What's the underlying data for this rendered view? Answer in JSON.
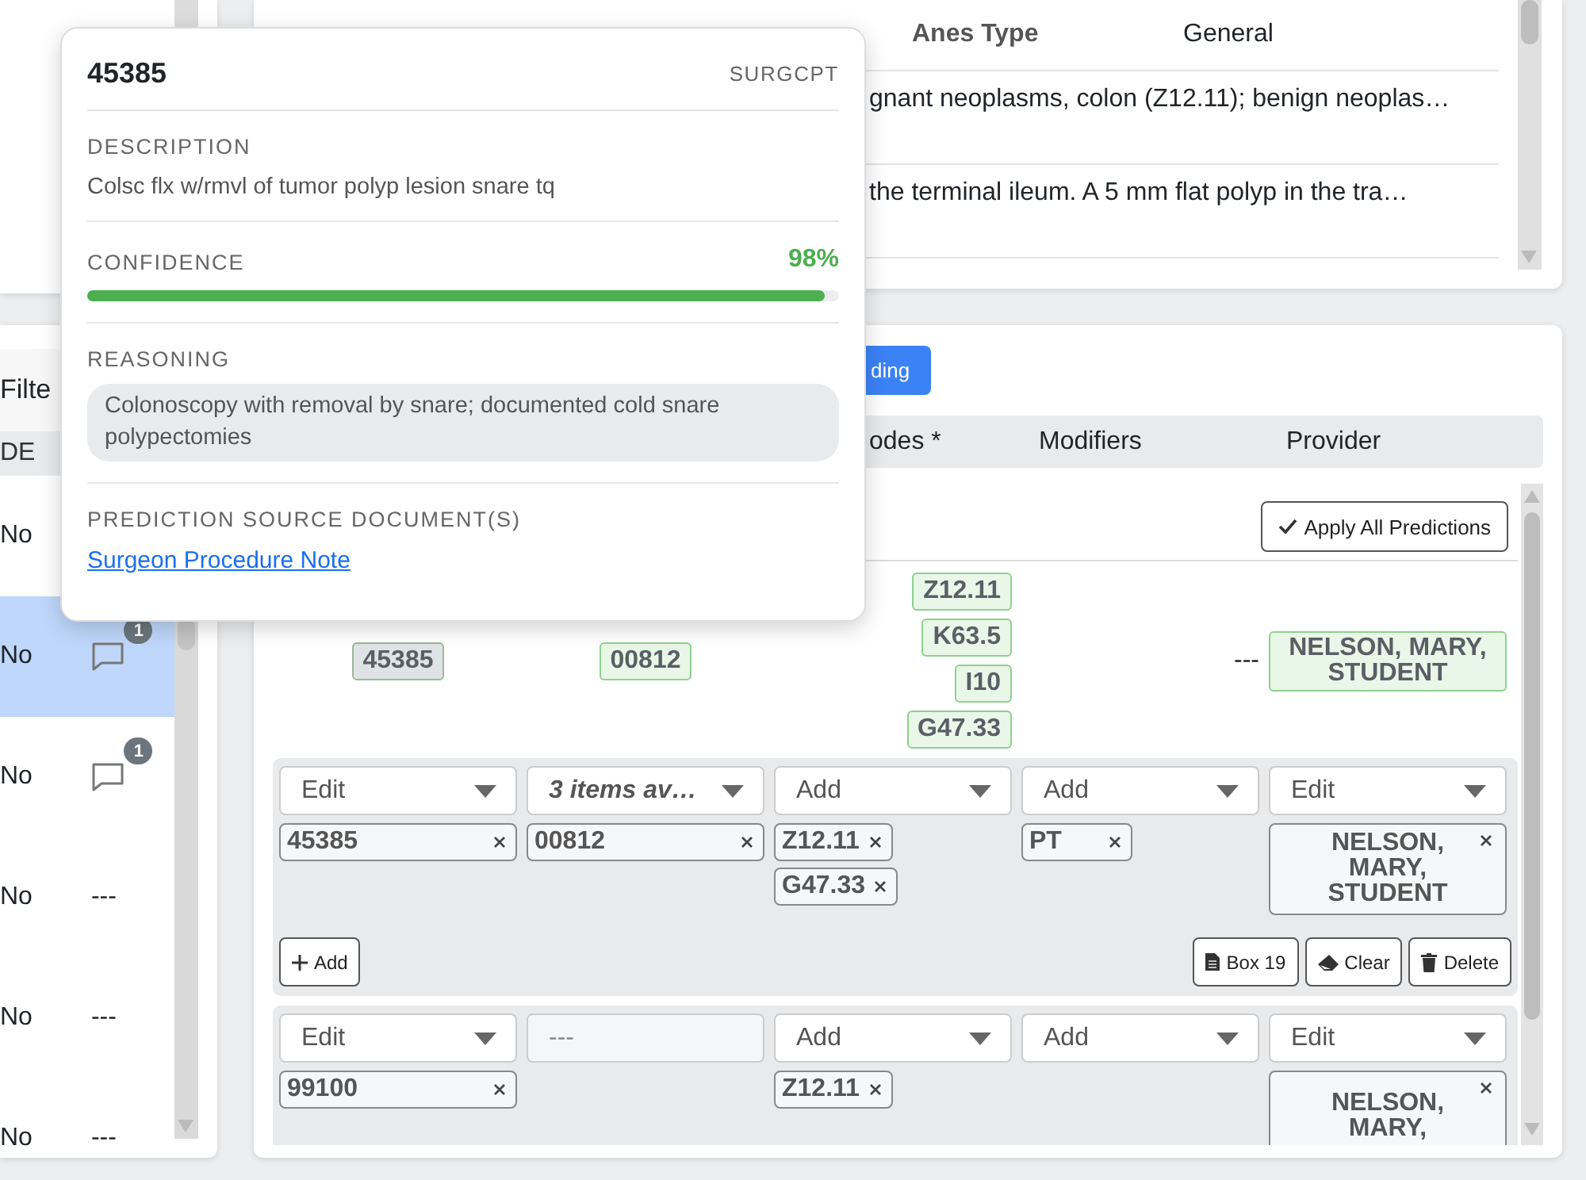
{
  "left_panel": {
    "filter_label": "Filte",
    "column_header": "DE",
    "rows": [
      {
        "value": "No",
        "selected": false,
        "kind": "blank"
      },
      {
        "value": "No",
        "selected": true,
        "kind": "comment",
        "comment_count": "1"
      },
      {
        "value": "No",
        "selected": false,
        "kind": "comment",
        "comment_count": "1"
      },
      {
        "value": "No",
        "selected": false,
        "kind": "text",
        "note": "---"
      },
      {
        "value": "No",
        "selected": false,
        "kind": "text",
        "note": "---"
      },
      {
        "value": "No",
        "selected": false,
        "kind": "text",
        "note": "---"
      }
    ]
  },
  "details_panel": {
    "fields": [
      {
        "label": "Anes Type",
        "value": "General"
      }
    ],
    "notes": [
      "gnant neoplasms, colon (Z12.11); benign neoplas…",
      "the terminal ileum. A 5 mm flat polyp in the tra…"
    ]
  },
  "coding_panel": {
    "tab": {
      "label": "ding",
      "selected": true
    },
    "columns": [
      "odes *",
      "Modifiers",
      "Provider"
    ],
    "apply_button": "Apply All Predictions",
    "prediction": {
      "procedure": {
        "code": "45385",
        "hovered": true
      },
      "anesthesia": "00812",
      "diagnoses": [
        "Z12.11",
        "K63.5",
        "I10",
        "G47.33"
      ],
      "modifier": "---",
      "provider": "NELSON, MARY, STUDENT"
    },
    "lines": [
      {
        "selects": [
          {
            "text": "Edit",
            "kind": "select"
          },
          {
            "text": "3 items av…",
            "kind": "summary"
          },
          {
            "text": "Add",
            "kind": "select"
          },
          {
            "text": "Add",
            "kind": "select"
          },
          {
            "text": "Edit",
            "kind": "select"
          }
        ],
        "procedures": [
          "45385"
        ],
        "anesthesia": [
          "00812"
        ],
        "diagnoses": [
          "Z12.11",
          "G47.33"
        ],
        "modifiers": [
          "PT"
        ],
        "provider": "NELSON, MARY, STUDENT",
        "add_button": "Add",
        "actions": [
          {
            "label": "Box 19",
            "kind": "file"
          },
          {
            "label": "Clear",
            "kind": "eraser"
          },
          {
            "label": "Delete",
            "kind": "trash"
          }
        ]
      },
      {
        "selects": [
          {
            "text": "Edit",
            "kind": "select"
          },
          {
            "text": "---",
            "kind": "disabled"
          },
          {
            "text": "Add",
            "kind": "select"
          },
          {
            "text": "Add",
            "kind": "select"
          },
          {
            "text": "Edit",
            "kind": "select"
          }
        ],
        "procedures": [
          "99100"
        ],
        "diagnoses": [
          "Z12.11"
        ],
        "provider": "NELSON, MARY,"
      }
    ]
  },
  "popover": {
    "code": "45385",
    "code_system": "SURGCPT",
    "description_label": "DESCRIPTION",
    "description": "Colsc flx w/rmvl of tumor polyp lesion snare tq",
    "confidence_label": "CONFIDENCE",
    "confidence_text": "98%",
    "level": 0.98,
    "reasoning_label": "REASONING",
    "reasoning": "Colonoscopy with removal by snare; documented cold snare polypectomies",
    "source_label": "PREDICTION SOURCE DOCUMENT(S)",
    "source_link": "Surgeon Procedure Note"
  }
}
